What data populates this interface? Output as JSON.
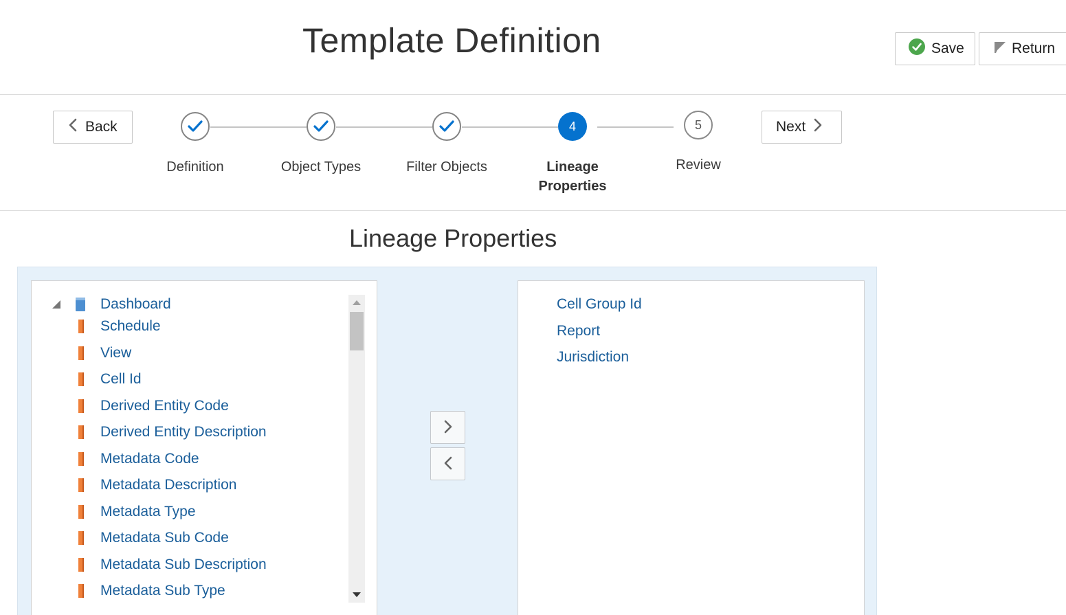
{
  "page": {
    "title": "Template Definition"
  },
  "header": {
    "save_label": "Save",
    "return_label": "Return",
    "colors": {
      "save_icon": "#4ca64c"
    }
  },
  "wizard": {
    "back_label": "Back",
    "next_label": "Next",
    "steps": [
      {
        "label": "Definition",
        "state": "done"
      },
      {
        "label": "Object Types",
        "state": "done"
      },
      {
        "label": "Filter Objects",
        "state": "done"
      },
      {
        "label": "Lineage Properties",
        "number": "4",
        "state": "current"
      },
      {
        "label": "Review",
        "number": "5",
        "state": "todo"
      }
    ],
    "colors": {
      "current": "#0572ce",
      "check": "#0572ce"
    }
  },
  "section": {
    "title": "Lineage Properties"
  },
  "available": {
    "root": {
      "label": "Dashboard",
      "icon": "page-icon",
      "expanded": true
    },
    "items": [
      "Schedule",
      "View",
      "Cell Id",
      "Derived Entity Code",
      "Derived Entity Description",
      "Metadata Code",
      "Metadata Description",
      "Metadata Type",
      "Metadata Sub Code",
      "Metadata Sub Description",
      "Metadata Sub Type"
    ],
    "item_icon": "property-icon"
  },
  "selected": {
    "items": [
      "Cell Group Id",
      "Report",
      "Jurisdiction"
    ]
  }
}
